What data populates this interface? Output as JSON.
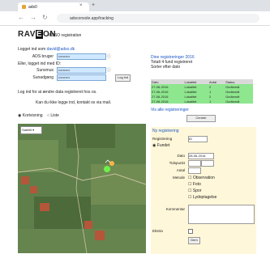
{
  "browser": {
    "tab_title": "ads0",
    "url": "adsconsole.app/tracking",
    "back": "←",
    "forward": "→",
    "reload": "↻",
    "tab_close": "×",
    "new_tab": "+"
  },
  "header": {
    "logo_left": "RAV",
    "logo_mid": "E",
    "logo_right": "ON",
    "subtitle": "ADSO registration"
  },
  "login": {
    "intro": "Logget ind som ",
    "user_link": "david@adso.dk",
    "user_label": "ADS bruger",
    "user_value": "••••••••••",
    "alt_intro": "Eller, logget ind med ID:",
    "pass_label": "Sunsmus",
    "pass_value": "••••••••••",
    "pass2_label": "Sunadgang",
    "pass2_value": "••••••••••",
    "login_button": "Log ind",
    "note1": "Log ind for at ændre data registreret hos os.",
    "note2": "Kan du ikke logge ind, kontakt os via mail."
  },
  "view_toggle": {
    "opt1": "Kortvisning",
    "opt2": "Liste"
  },
  "map": {
    "select_value": "Satellit"
  },
  "results": {
    "heading": "Dine registreringer 2016",
    "line1": "Totalt 4 fund registreret",
    "line2": "Sorter efter dato",
    "columns": [
      "Dato",
      "Lokalitet",
      "Antal",
      "Status"
    ],
    "rows": [
      [
        "27-06-2016",
        "Lokalitet",
        "2",
        "Godkendt"
      ],
      [
        "27-06-2016",
        "Lokalitet",
        "1",
        "Godkendt"
      ],
      [
        "27-06-2016",
        "Lokalitet",
        "2",
        "Godkendt"
      ],
      [
        "27-06-2016",
        "Lokalitet",
        "1",
        "Godkendt"
      ]
    ],
    "footer": "Vis alle registreringer",
    "center_button": "Centrér"
  },
  "form": {
    "heading": "Ny registrering",
    "field1_label": "Registrering",
    "field1_value": "ID",
    "radio_label": "Fundet",
    "date_label": "Dato",
    "date_value": "28-06-2016",
    "time_label": "Tidspunkt",
    "count_label": "Antal",
    "method_label": "Metode",
    "methods": [
      "Observation",
      "Foto",
      "Spor",
      "Lydoptagelse"
    ],
    "comment_label": "Kommentar",
    "extra_label": "Ekstra",
    "submit_label": "Gem"
  }
}
